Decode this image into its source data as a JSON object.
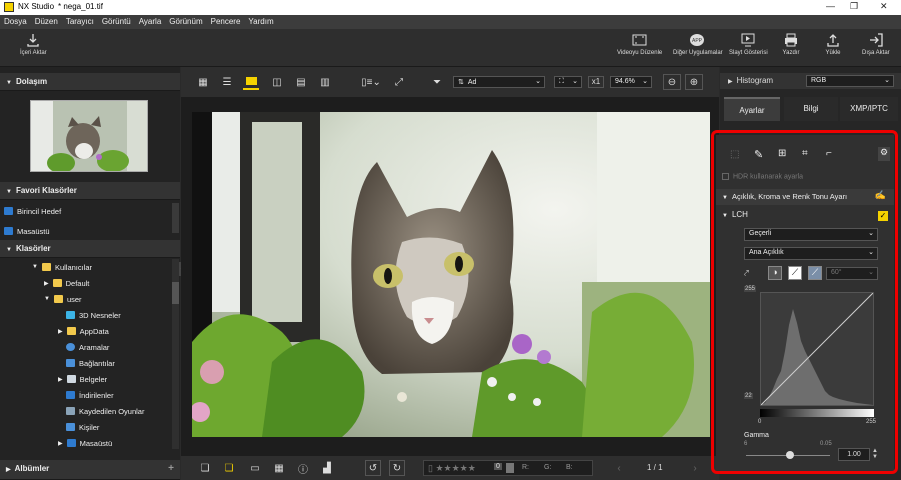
{
  "titlebar": {
    "app": "NX Studio",
    "file": "* nega_01.tif"
  },
  "menu": [
    "Dosya",
    "Düzen",
    "Tarayıcı",
    "Görüntü",
    "Ayarla",
    "Görünüm",
    "Pencere",
    "Yardım"
  ],
  "toolbar": {
    "import": "İçeri Aktar",
    "video_edit": "Videoyu Düzenle",
    "other_apps": "Diğer Uygulamalar",
    "slideshow": "Slayt Gösterisi",
    "print": "Yazdır",
    "upload": "Yükle",
    "export": "Dışa Aktar"
  },
  "left": {
    "navigation": "Dolaşım",
    "favorites": "Favori Klasörler",
    "favorite_items": [
      "Birincil Hedef",
      "Masaüstü"
    ],
    "folders": "Klasörler",
    "tree": [
      {
        "label": "Kullanıcılar",
        "expanded": true
      },
      {
        "label": "Default",
        "expanded": false
      },
      {
        "label": "user",
        "expanded": true
      },
      {
        "label": "3D Nesneler"
      },
      {
        "label": "AppData"
      },
      {
        "label": "Aramalar"
      },
      {
        "label": "Bağlantılar"
      },
      {
        "label": "Belgeler"
      },
      {
        "label": "İndirilenler"
      },
      {
        "label": "Kaydedilen Oyunlar"
      },
      {
        "label": "Kişiler"
      },
      {
        "label": "Masaüstü"
      }
    ],
    "albums": "Albümler"
  },
  "viewbar": {
    "sort": "Ad",
    "zoom_mult": "x1",
    "zoom": "94.6%"
  },
  "bottombar": {
    "r": "R:",
    "g": "G:",
    "b": "B:",
    "pages": "1 / 1",
    "rating_label": "0"
  },
  "right": {
    "histogram": "Histogram",
    "histogram_channel": "RGB",
    "tabs": [
      "Ayarlar",
      "Bilgi",
      "XMP/IPTC"
    ],
    "hdr": "HDR kullanarak ayarla",
    "section": "Açıklık, Kroma ve Renk Tonu Ayarı",
    "lch": "LCH",
    "mode": "Geçerli",
    "channel": "Ana Açıklık",
    "angle": "60°",
    "curve_top": "255",
    "curve_left": "22",
    "curve_bottom_left": "0",
    "curve_bottom_right": "255",
    "gamma_label": "Gamma",
    "gamma_min": "6",
    "gamma_max": "0.05",
    "gamma_value": "1.00"
  },
  "colors": {
    "accent": "#f5d200",
    "highlight": "#e00000"
  }
}
